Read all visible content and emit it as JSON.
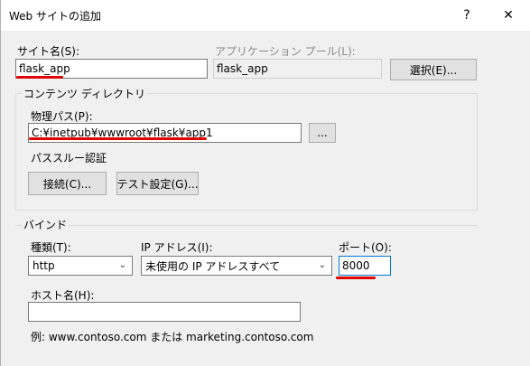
{
  "window": {
    "title": "Web サイトの追加",
    "help_glyph": "?",
    "close_glyph": "✕"
  },
  "site_name": {
    "label": "サイト名(S):",
    "value": "flask_app"
  },
  "app_pool": {
    "label": "アプリケーション プール(L):",
    "value": "flask_app",
    "select_button": "選択(E)..."
  },
  "content_dir": {
    "group_title": "コンテンツ ディレクトリ",
    "physical_path_label": "物理パス(P):",
    "physical_path_value": "C:¥inetpub¥wwwroot¥flask¥app1",
    "browse_button": "...",
    "passthrough_label": "パススルー認証",
    "connect_button": "接続(C)...",
    "test_button": "テスト設定(G)..."
  },
  "binding": {
    "group_title": "バインド",
    "type_label": "種類(T):",
    "type_value": "http",
    "ip_label": "IP アドレス(I):",
    "ip_value": "未使用の IP アドレスすべて",
    "port_label": "ポート(O):",
    "port_value": "8000",
    "host_label": "ホスト名(H):",
    "host_value": "",
    "example_text": "例: www.contoso.com または marketing.contoso.com"
  },
  "colors": {
    "accent": "#0078d7",
    "annotation": "#e00000"
  }
}
